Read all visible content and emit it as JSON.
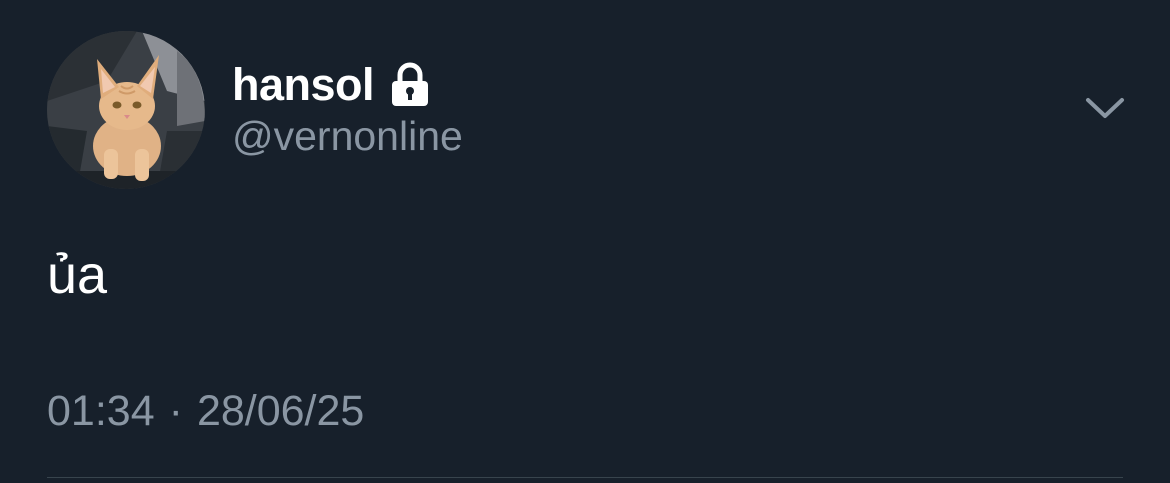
{
  "tweet": {
    "author": {
      "display_name": "hansol",
      "handle": "@vernonline",
      "protected": true,
      "avatar_icon": "kitten-avatar",
      "lock_icon": "lock-icon"
    },
    "text": "ủa",
    "time": "01:34",
    "separator": "·",
    "date": "28/06/25",
    "menu_icon": "chevron-down-icon"
  },
  "colors": {
    "background": "#17202b",
    "primary_text": "#ffffff",
    "secondary_text": "#8a96a3",
    "divider": "#38444d"
  }
}
